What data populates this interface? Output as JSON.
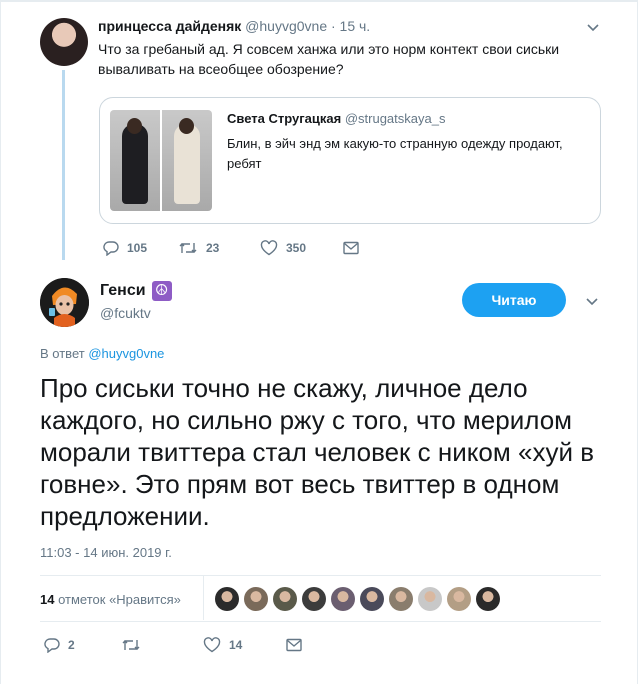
{
  "parent": {
    "name": "принцесса дайденяк",
    "handle": "@huyvg0vne",
    "time": "· 15 ч.",
    "text": "Что за гребаный ад. Я совсем ханжа или это норм контект свои сиськи вываливать на всеобщее обозрение?",
    "quote": {
      "name": "Света Стругацкая",
      "handle": "@strugatskaya_s",
      "text": "Блин, в эйч энд эм какую-то странную одежду продают, ребят"
    },
    "actions": {
      "replies": "105",
      "retweets": "23",
      "likes": "350"
    }
  },
  "main": {
    "name": "Генси",
    "handle": "@fcuktv",
    "name_emoji": "☮",
    "follow_label": "Читаю",
    "reply_prefix": "В ответ",
    "reply_handle": "@huyvg0vne",
    "text": "Про сиськи точно не скажу, личное дело каждого, но сильно ржу с того, что мерилом морали твиттера стал человек с ником «хуй в говне». Это прям вот весь твиттер в одном предложении.",
    "timestamp": "11:03 - 14 июн. 2019 г.",
    "likes_count": "14",
    "likes_label": "отметок «Нравится»",
    "actions": {
      "replies": "2",
      "retweets": "",
      "likes": "14"
    }
  },
  "icons": {
    "reply": "reply-icon",
    "retweet": "retweet-icon",
    "like": "heart-icon",
    "dm": "mail-icon",
    "more": "chevron-down-icon"
  },
  "colors": {
    "accent": "#1da1f2",
    "thread_line": "#b9d9ef",
    "muted": "#657786",
    "border": "#e6ecf0"
  },
  "liker_avatars": [
    "#2b2b2b",
    "#7a6a5a",
    "#5a5a4a",
    "#3c3c3c",
    "#6b5e70",
    "#4a4a5a",
    "#8a7d6d",
    "#c8c8c8",
    "#b39e85",
    "#2a2a2a"
  ]
}
